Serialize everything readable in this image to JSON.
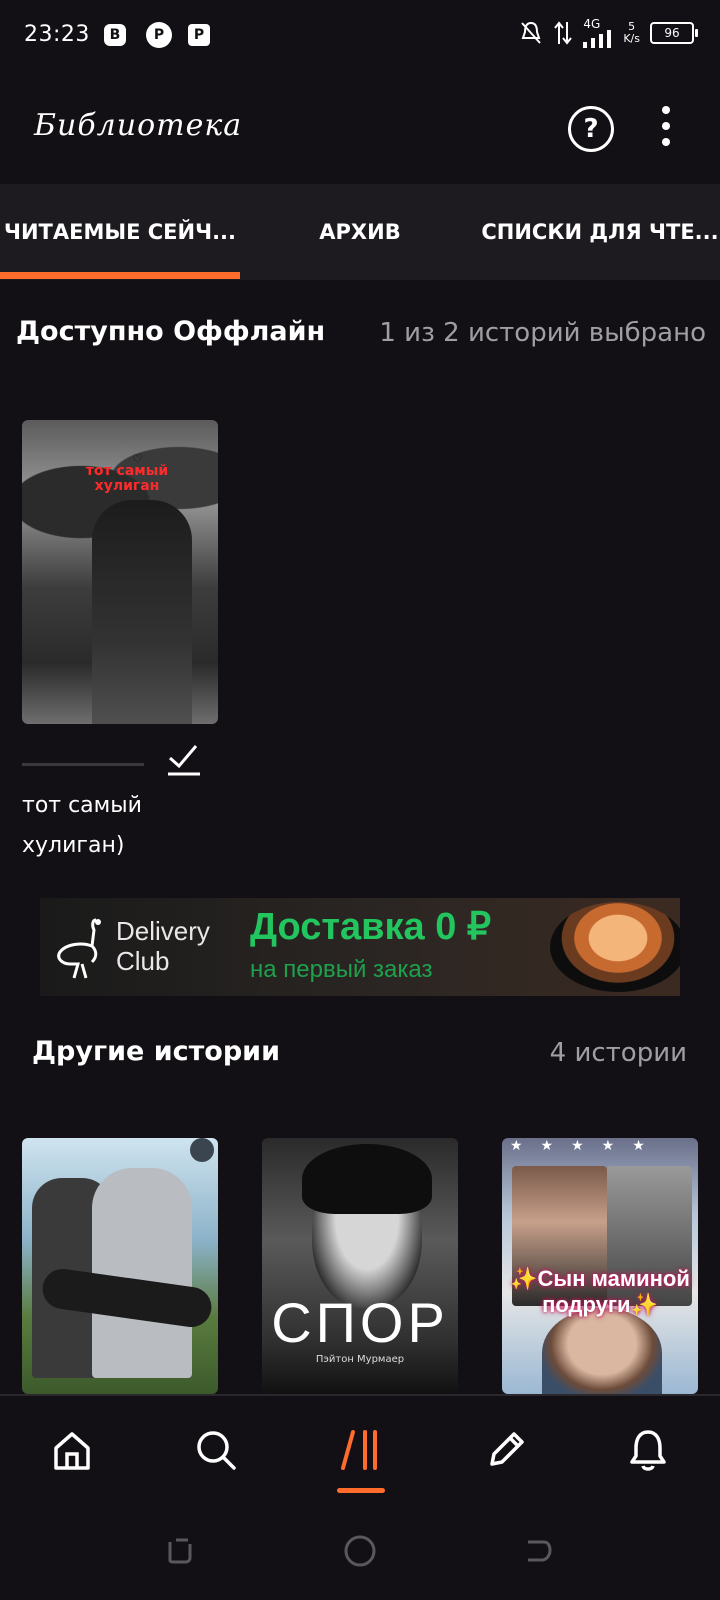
{
  "status_bar": {
    "time": "23:23",
    "network": "4G",
    "speed": "5\nK/s",
    "battery": "96"
  },
  "app_bar": {
    "title": "Библиотека",
    "help_icon": "help-circle-icon",
    "menu_icon": "more-vertical-icon"
  },
  "tabs": [
    {
      "label": "ЧИТАЕМЫЕ СЕЙЧ...",
      "active": true
    },
    {
      "label": "АРХИВ",
      "active": false
    },
    {
      "label": "СПИСКИ ДЛЯ ЧТЕ...",
      "active": false
    }
  ],
  "offline_section": {
    "title": "Доступно Оффлайн",
    "count": "1 из 2 историй выбрано",
    "stories": [
      {
        "cover_text": "тот самый хулиган",
        "title": "тот самый хулиган)",
        "selected": true
      }
    ]
  },
  "ad": {
    "brand": "Delivery\nClub",
    "headline": "Доставка 0 ₽",
    "subline": "на первый заказ"
  },
  "other_section": {
    "title": "Другие истории",
    "count": "4 истории",
    "covers": [
      {
        "title": ""
      },
      {
        "title": "СПОР",
        "author": "Пэйтон Мурмаер"
      },
      {
        "title": "✨Сын маминой подруги✨"
      }
    ]
  },
  "bottom_nav": {
    "items": [
      {
        "icon": "home-icon",
        "active": false
      },
      {
        "icon": "search-icon",
        "active": false
      },
      {
        "icon": "library-icon",
        "active": true
      },
      {
        "icon": "pencil-icon",
        "active": false
      },
      {
        "icon": "bell-icon",
        "active": false
      }
    ]
  },
  "colors": {
    "accent": "#ff6c2c",
    "background": "#121014",
    "tab_bar": "#1d1b1f",
    "muted_text": "#a09ea3",
    "ad_green": "#22c55e"
  }
}
